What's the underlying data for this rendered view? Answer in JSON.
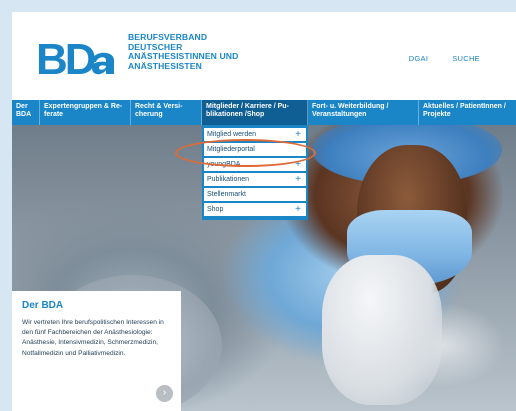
{
  "brand": {
    "logo_letters": "BDA",
    "name_lines": [
      "BERUFSVERBAND",
      "DEUTSCHER",
      "ANÄSTHESISTINNEN UND",
      "ANÄSTHESISTEN"
    ],
    "color": "#1a86c8"
  },
  "top_links": [
    {
      "label": "DGAI"
    },
    {
      "label": "SUCHE"
    }
  ],
  "nav": {
    "items": [
      {
        "label": "Der BDA"
      },
      {
        "label": "Expertengruppen & Re-ferate"
      },
      {
        "label": "Recht & Versi-cherung"
      },
      {
        "label": "Mitglieder / Karriere / Pu-blikationen /Shop",
        "active": true
      },
      {
        "label": "Fort- u. Weiterbildung / Veranstaltungen"
      },
      {
        "label": "Aktuelles / PatientInnen / Projekte"
      }
    ]
  },
  "dropdown": {
    "items": [
      {
        "label": "Mitglied werden",
        "has_sub": true
      },
      {
        "label": "Mitgliederportal",
        "has_sub": false,
        "highlighted": true
      },
      {
        "label": "youngBDA",
        "has_sub": true
      },
      {
        "label": "Publikationen",
        "has_sub": true
      },
      {
        "label": "Stellenmarkt",
        "has_sub": false
      },
      {
        "label": "Shop",
        "has_sub": true
      }
    ],
    "plus_symbol": "+"
  },
  "card": {
    "title": "Der BDA",
    "text": "Wir vertreten Ihre berufspolitischen Interessen in den fünf Fachbereichen der Anästhesiologie: Anästhesie, Intensivmedizin, Schmerzmedizin, Notfallmedizin und Palliativmedizin.",
    "arrow_icon": "chevron-right-icon"
  },
  "colors": {
    "accent": "#1a86c8",
    "active_nav": "#0f5f95",
    "highlight_ring": "#e06a35"
  }
}
